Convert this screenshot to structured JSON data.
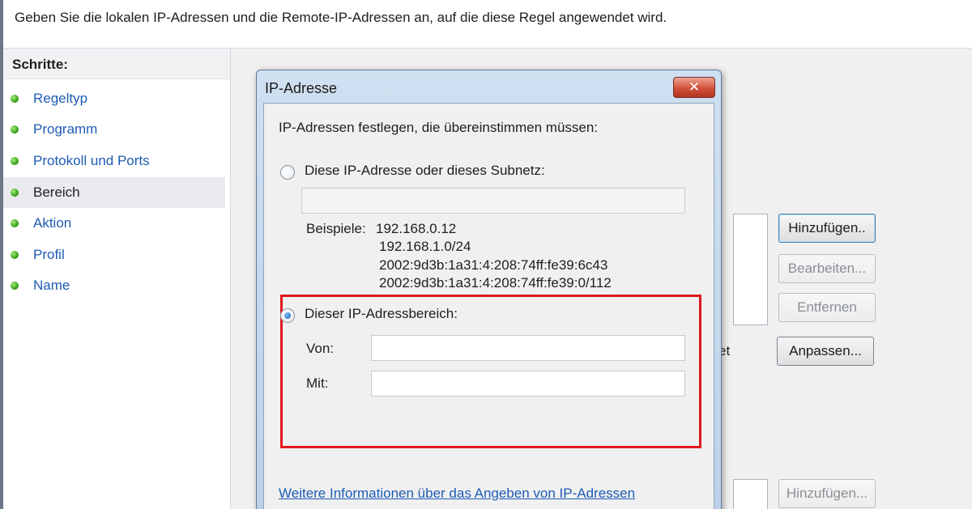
{
  "header": {
    "text": "Geben Sie die lokalen IP-Adressen und die Remote-IP-Adressen an, auf die diese Regel angewendet wird."
  },
  "sidebar": {
    "title": "Schritte:",
    "items": [
      {
        "label": "Regeltyp"
      },
      {
        "label": "Programm"
      },
      {
        "label": "Protokoll und Ports"
      },
      {
        "label": "Bereich"
      },
      {
        "label": "Aktion"
      },
      {
        "label": "Profil"
      },
      {
        "label": "Name"
      }
    ],
    "active": "Bereich"
  },
  "background": {
    "buttons": {
      "add": "Hinzufügen..",
      "edit": "Bearbeiten...",
      "remove": "Entfernen",
      "customize": "Anpassen...",
      "add2": "Hinzufügen..."
    },
    "partial_text": "et"
  },
  "dialog": {
    "title": "IP-Adresse",
    "close_label": "✕",
    "instruction": "IP-Adressen festlegen, die übereinstimmen müssen:",
    "option_single": {
      "label": "Diese IP-Adresse oder dieses Subnetz:",
      "value": "",
      "selected": false
    },
    "examples_label": "Beispiele:",
    "examples": [
      "192.168.0.12",
      "192.168.1.0/24",
      "2002:9d3b:1a31:4:208:74ff:fe39:6c43",
      "2002:9d3b:1a31:4:208:74ff:fe39:0/112"
    ],
    "option_range": {
      "label": "Dieser IP-Adressbereich:",
      "selected": true,
      "from_label": "Von:",
      "from_value": "",
      "to_label": "Mit:",
      "to_value": ""
    },
    "link": "Weitere Informationen über das Angeben von IP-Adressen"
  },
  "colors": {
    "link": "#1d5bb5",
    "highlight": "#e0181e",
    "status_dot": "#3aa31d"
  }
}
